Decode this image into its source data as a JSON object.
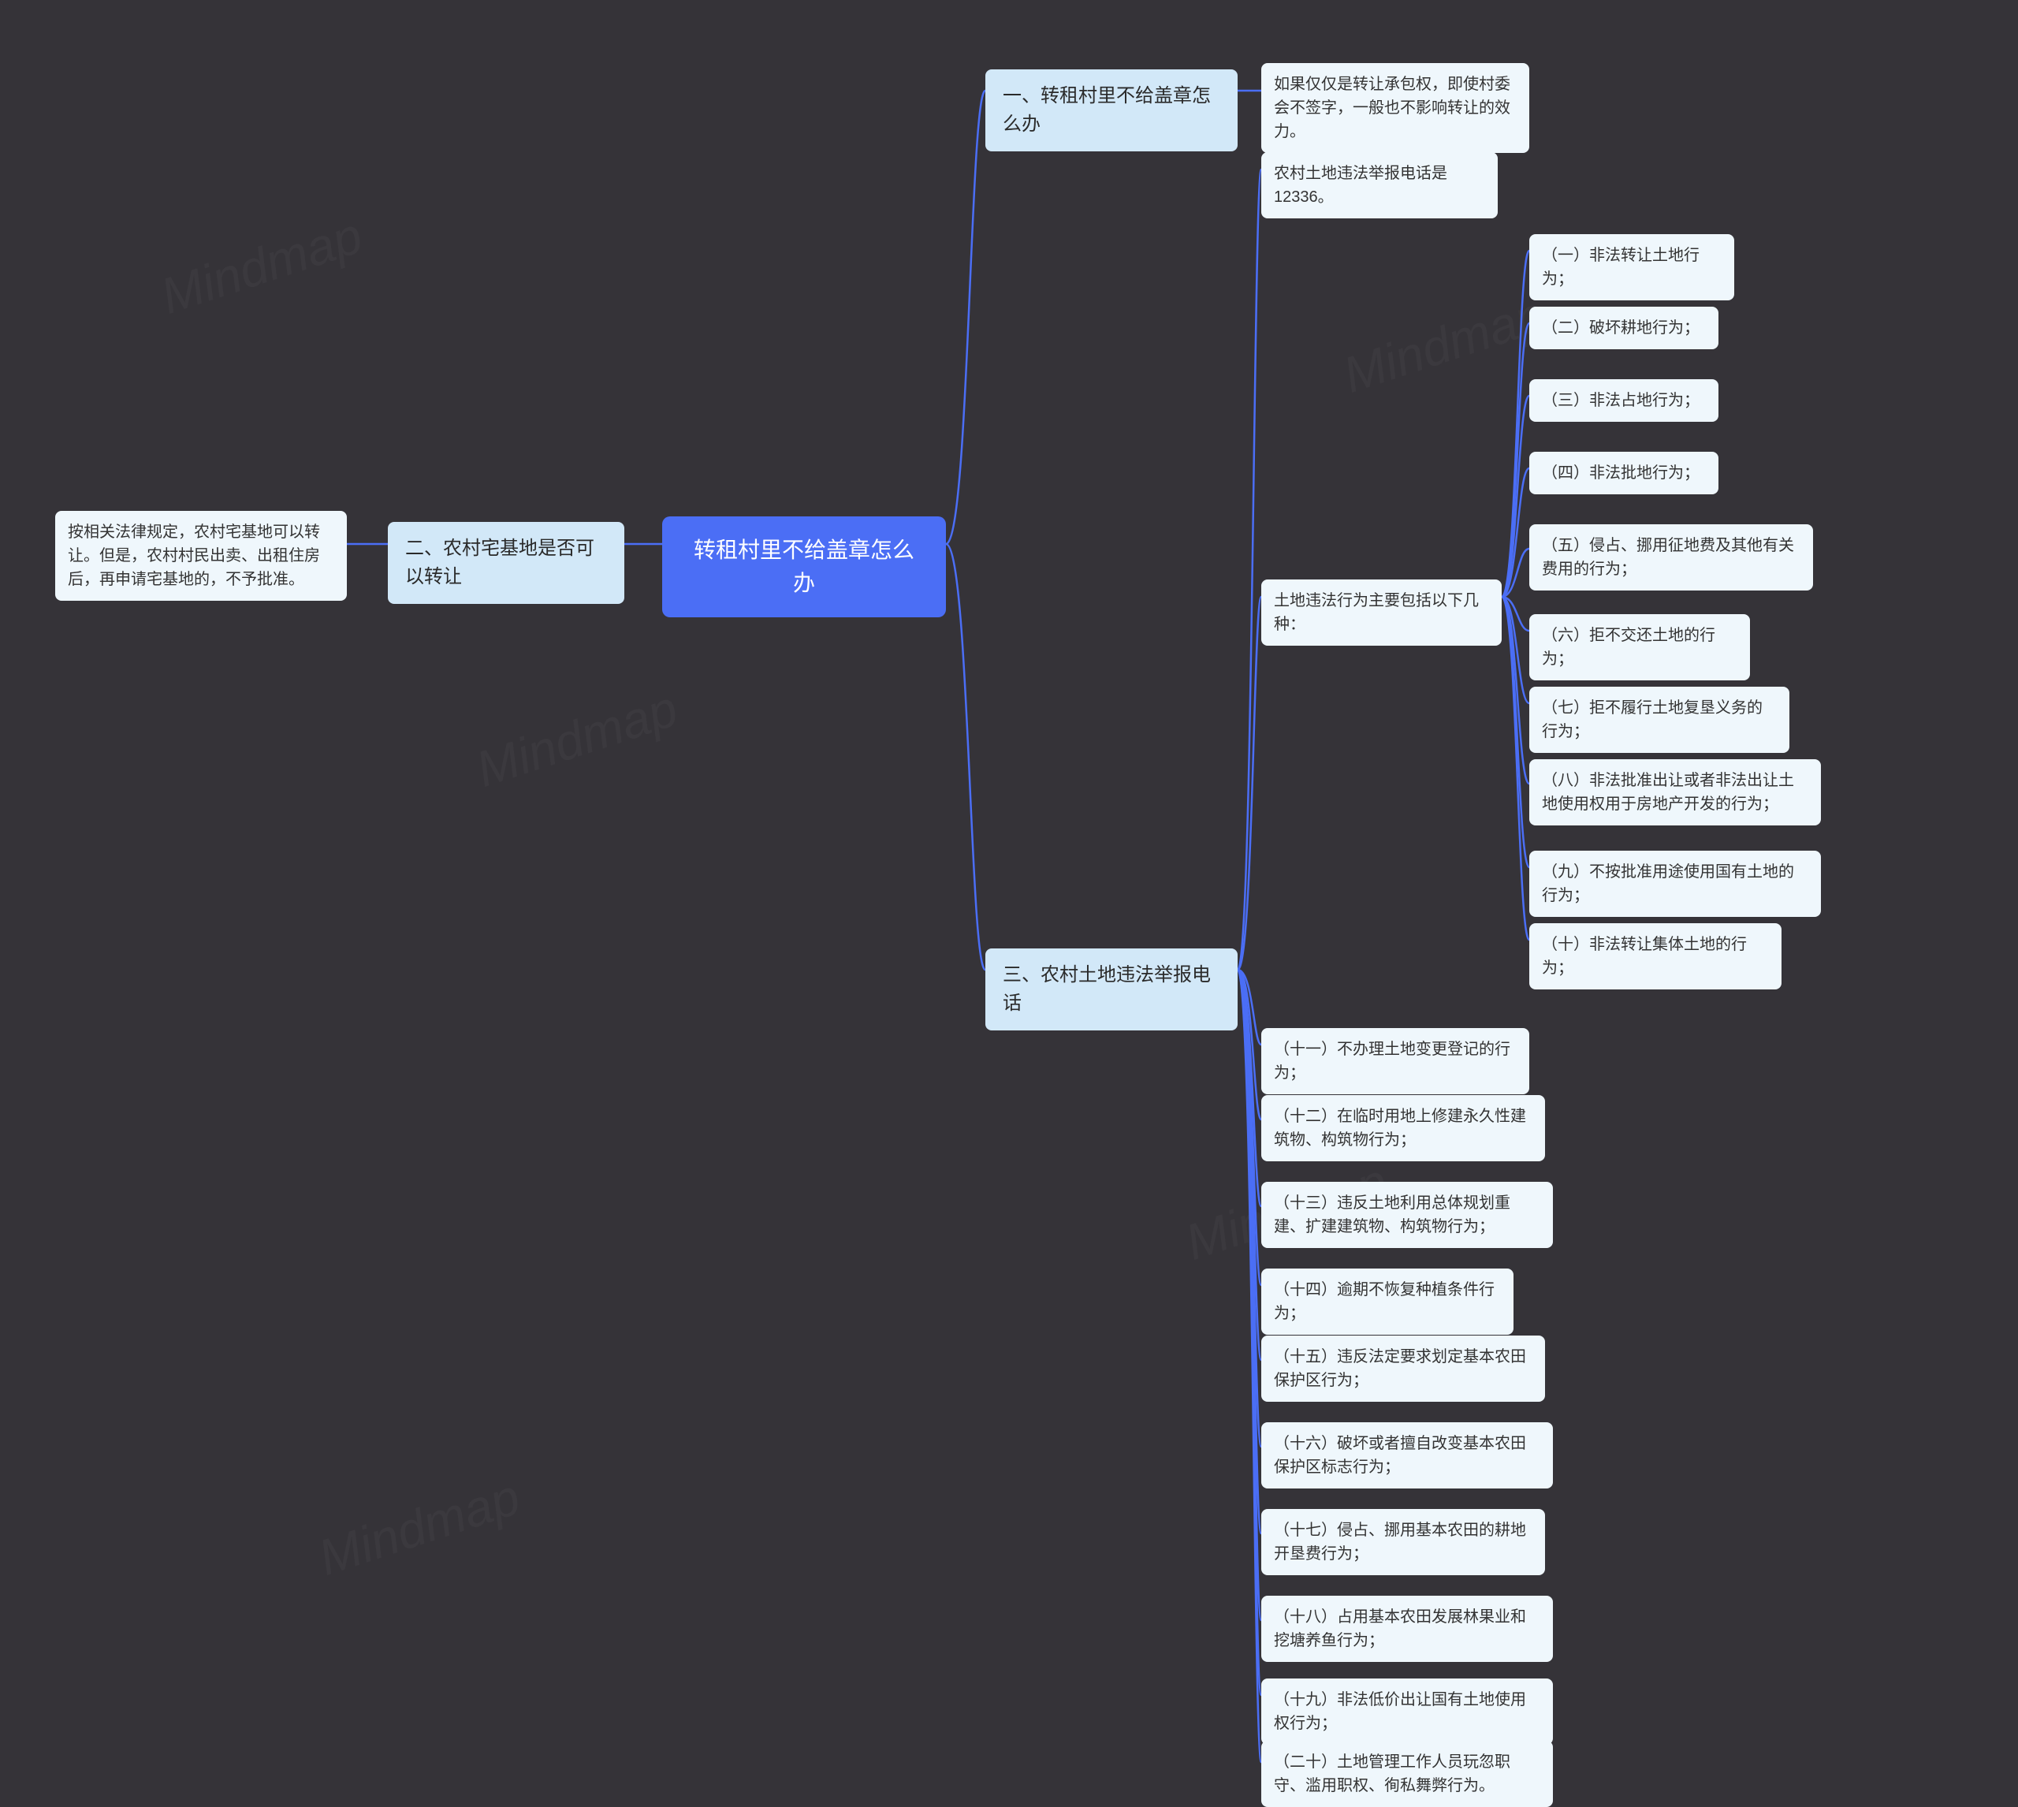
{
  "root": {
    "text": "转租村里不给盖章怎么办"
  },
  "branch1": {
    "label": "一、转租村里不给盖章怎么办",
    "note": "如果仅仅是转让承包权，即使村委会不签字，一般也不影响转让的效力。"
  },
  "branch2": {
    "label": "二、农村宅基地是否可以转让",
    "note": "按相关法律规定，农村宅基地可以转让。但是，农村村民出卖、出租住房后，再申请宅基地的，不予批准。"
  },
  "branch3": {
    "label": "三、农村土地违法举报电话",
    "phone": "农村土地违法举报电话是12336。",
    "typesHeader": "土地违法行为主要包括以下几种：",
    "types": [
      "（一）非法转让土地行为；",
      "（二）破坏耕地行为；",
      "（三）非法占地行为；",
      "（四）非法批地行为；",
      "（五）侵占、挪用征地费及其他有关费用的行为；",
      "（六）拒不交还土地的行为；",
      "（七）拒不履行土地复垦义务的行为；",
      "（八）非法批准出让或者非法出让土地使用权用于房地产开发的行为；",
      "（九）不按批准用途使用国有土地的行为；",
      "（十）非法转让集体土地的行为；"
    ],
    "more": [
      "（十一）不办理土地变更登记的行为；",
      "（十二）在临时用地上修建永久性建筑物、构筑物行为；",
      "（十三）违反土地利用总体规划重建、扩建建筑物、构筑物行为；",
      "（十四）逾期不恢复种植条件行为；",
      "（十五）违反法定要求划定基本农田保护区行为；",
      "（十六）破坏或者擅自改变基本农田保护区标志行为；",
      "（十七）侵占、挪用基本农田的耕地开垦费行为；",
      "（十八）占用基本农田发展林果业和挖塘养鱼行为；",
      "（十九）非法低价出让国有土地使用权行为；",
      "（二十）土地管理工作人员玩忽职守、滥用职权、徇私舞弊行为。"
    ]
  }
}
